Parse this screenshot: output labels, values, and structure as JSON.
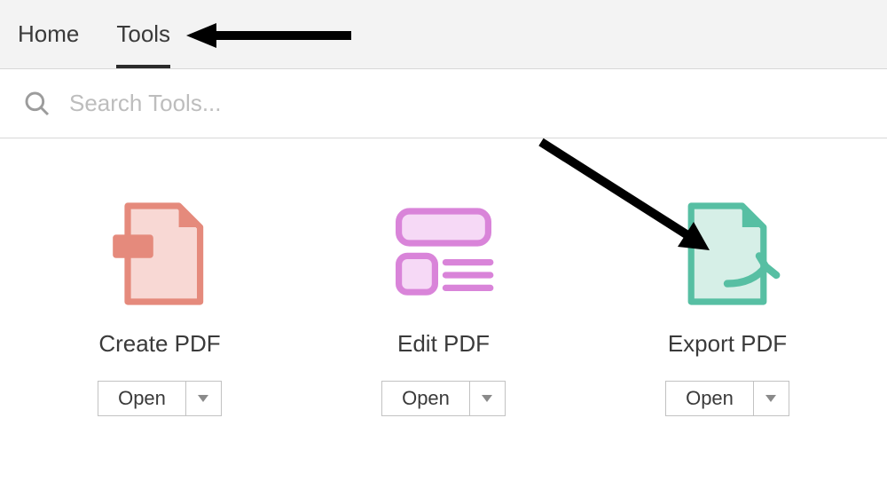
{
  "tabs": {
    "home": "Home",
    "tools": "Tools",
    "active": "tools"
  },
  "search": {
    "placeholder": "Search Tools..."
  },
  "tools_list": [
    {
      "id": "create-pdf",
      "label": "Create PDF",
      "button": "Open",
      "color": "#e58a7c",
      "fill": "#f8d8d4"
    },
    {
      "id": "edit-pdf",
      "label": "Edit PDF",
      "button": "Open",
      "color": "#d984d9",
      "fill": "#f6d9f6"
    },
    {
      "id": "export-pdf",
      "label": "Export PDF",
      "button": "Open",
      "color": "#57bfa3",
      "fill": "#d6efe7"
    }
  ]
}
